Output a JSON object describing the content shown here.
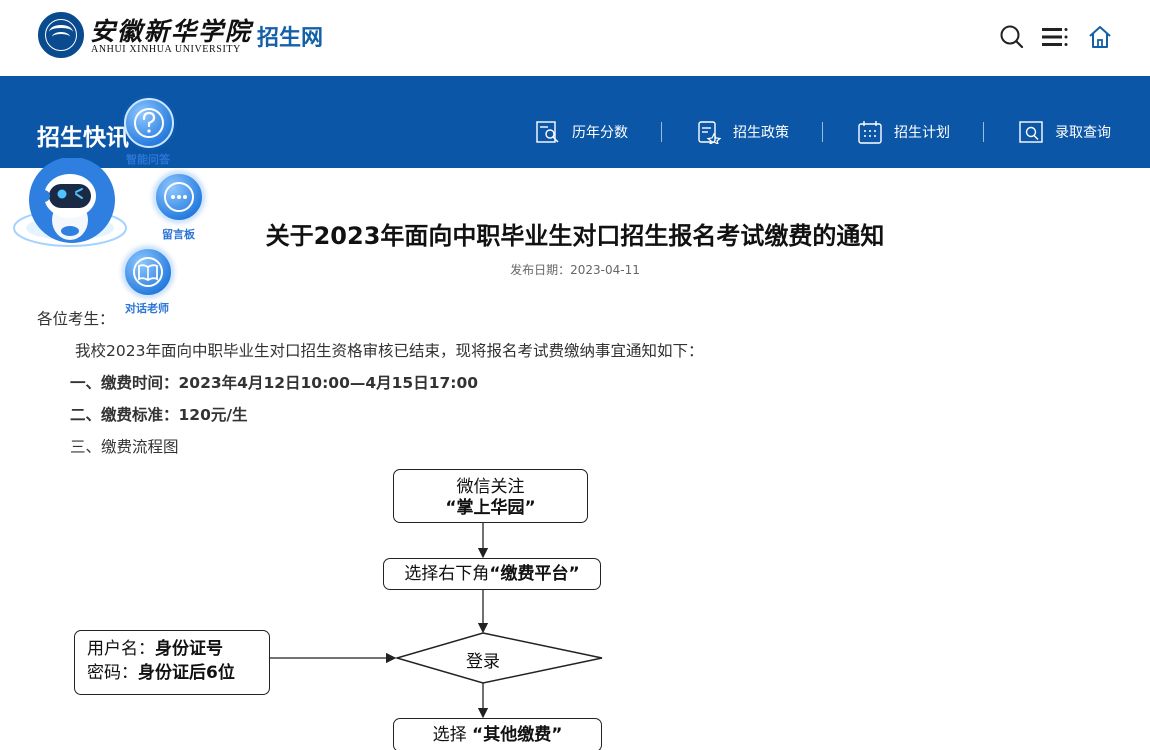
{
  "header": {
    "logo_cn": "安徽新华学院",
    "logo_en": "ANHUI XINHUA UNIVERSITY",
    "site_name": "招生网",
    "icons": [
      "search-icon",
      "menu-icon",
      "home-icon"
    ]
  },
  "band": {
    "title": "招生快讯",
    "nav": [
      {
        "label": "历年分数",
        "icon": "score-history-icon"
      },
      {
        "label": "招生政策",
        "icon": "policy-icon"
      },
      {
        "label": "招生计划",
        "icon": "calendar-icon"
      },
      {
        "label": "录取查询",
        "icon": "admission-search-icon"
      }
    ]
  },
  "widget": {
    "items": [
      {
        "label": "智能问答",
        "icon": "question-icon"
      },
      {
        "label": "留言板",
        "icon": "chat-dots-icon"
      },
      {
        "label": "对话老师",
        "icon": "book-icon"
      }
    ]
  },
  "article": {
    "title": "关于2023年面向中职毕业生对口招生报名考试缴费的通知",
    "date": "发布日期：2023-04-11",
    "greeting": "各位考生：",
    "intro": "我校2023年面向中职毕业生对口招生资格审核已结束，现将报名考试费缴纳事宜通知如下：",
    "item1_label": "一、缴费时间：",
    "item1_value": "2023年4月12日10:00—4月15日17:00",
    "item2_label": "二、缴费标准：",
    "item2_value": "120元/生",
    "item3_label": "三、缴费流程图"
  },
  "flowchart": {
    "step1_line1": "微信关注",
    "step1_line2": "“掌上华园”",
    "step2_prefix": "选择右下角",
    "step2_bold": "“缴费平台”",
    "login": "登录",
    "cred_user_label": "用户名：",
    "cred_user_value": "身份证号",
    "cred_pass_label": "密码：",
    "cred_pass_value": "身份证后6位",
    "step4_prefix": "选择",
    "step4_bold": "“其他缴费”"
  },
  "colors": {
    "brand_blue": "#0b56a6",
    "site_name_blue": "#1460a8",
    "widget_blue": "#2b7fe0"
  }
}
